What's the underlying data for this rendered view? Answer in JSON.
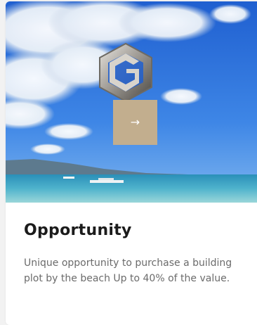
{
  "card": {
    "title": "Opportunity",
    "description": "Unique opportunity to purchase a building plot by the beach Up to 40% of the value.",
    "arrow_label": "→",
    "image_icon": "beach-sky-photo",
    "logo_icon": "hexagon-brand-logo"
  },
  "colors": {
    "accent": "#c2ae8e",
    "title": "#1b1b1b",
    "body_text": "#6b6b6b"
  }
}
